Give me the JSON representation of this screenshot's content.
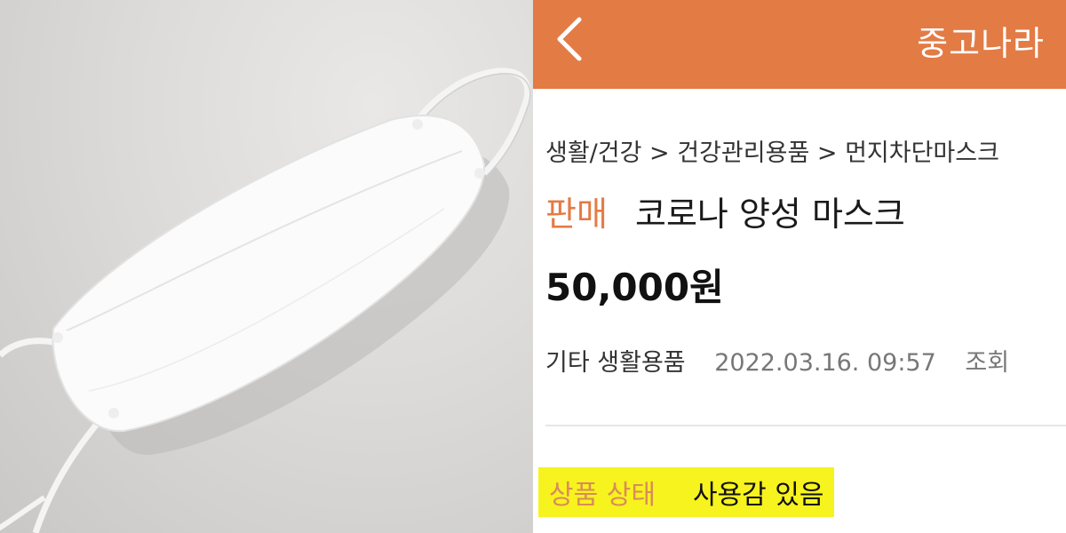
{
  "header": {
    "title": "중고나라",
    "back_icon": "chevron-left-icon",
    "background_color": "#e37b45"
  },
  "listing": {
    "breadcrumb": "생활/건강 > 건강관리용품 > 먼지차단마스크",
    "status_badge": "판매",
    "title": "코로나 양성 마스크",
    "price": "50,000원",
    "category": "기타 생활용품",
    "posted_at": "2022.03.16. 09:57",
    "views_label": "조회"
  },
  "condition": {
    "label": "상품 상태",
    "value": "사용감 있음",
    "highlight_color": "#f7f31e"
  },
  "photo": {
    "subject": "white-face-mask"
  }
}
